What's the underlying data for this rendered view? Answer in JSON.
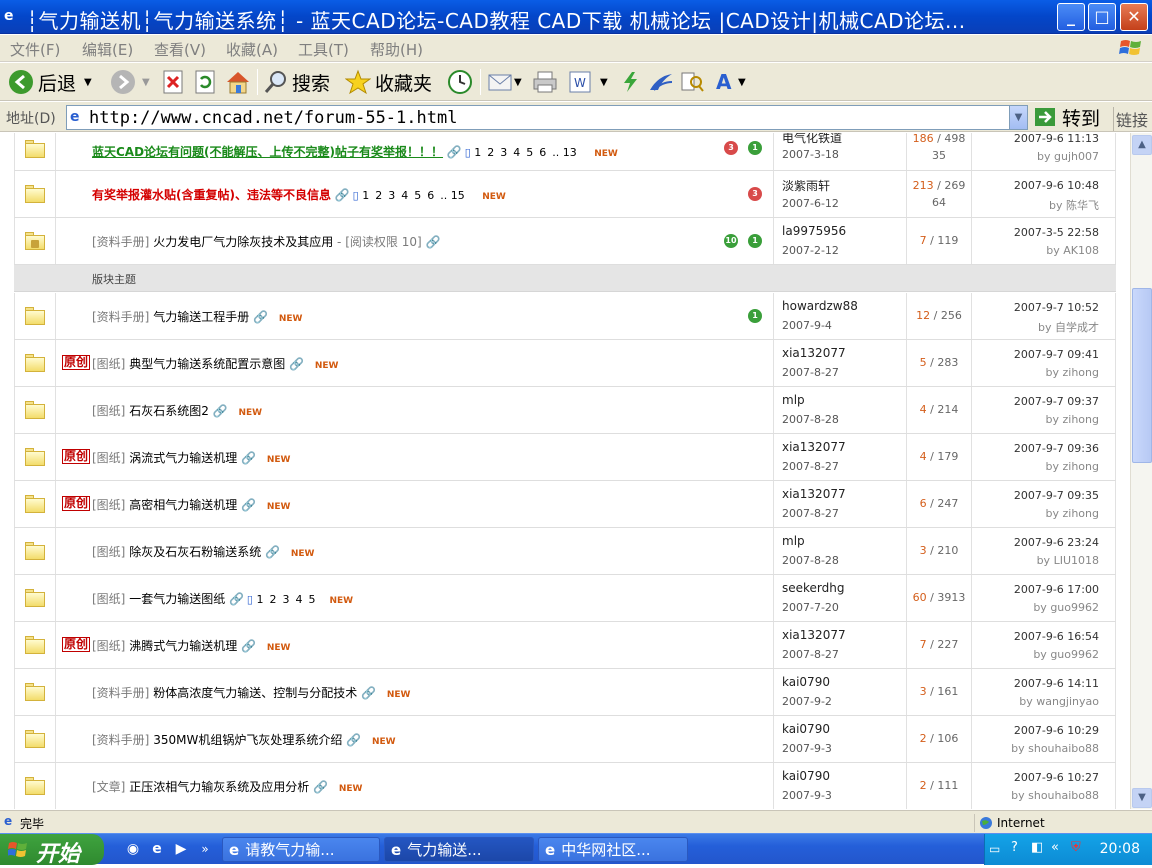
{
  "window": {
    "title": "┆气力输送机┆气力输送系统┆ - 蓝天CAD论坛-CAD教程 CAD下载 机械论坛 |CAD设计|机械CAD论坛...",
    "minimize": "_",
    "maximize": "□",
    "close": "✕"
  },
  "menu": [
    "文件(F)",
    "编辑(E)",
    "查看(V)",
    "收藏(A)",
    "工具(T)",
    "帮助(H)"
  ],
  "toolbar": {
    "back": "后退",
    "search": "搜索",
    "favorites": "收藏夹"
  },
  "address": {
    "label": "地址(D)",
    "url": "http://www.cncad.net/forum-55-1.html",
    "go": "转到",
    "links": "链接"
  },
  "section_label": "版块主题",
  "pinned": [
    {
      "title": "蓝天CAD论坛有问题(不能解压、上传不完整)帖子有奖举报！！！",
      "pages": [
        "1",
        "2",
        "3",
        "4",
        "5",
        "6",
        ".. 13"
      ],
      "new": "NEW",
      "author": "电气化铁道",
      "author_date": "2007-3-18",
      "replies": "186",
      "views": "498",
      "extra": "35",
      "last_date": "2007-9-6 11:13",
      "last_by": "by gujh007",
      "rate_up": "3",
      "rate_green": "1"
    },
    {
      "title": "有奖举报灌水贴(含重复帖)、违法等不良信息",
      "pages": [
        "1",
        "2",
        "3",
        "4",
        "5",
        "6",
        ".. 15"
      ],
      "new": "NEW",
      "author": "淡紫雨轩",
      "author_date": "2007-6-12",
      "replies": "213",
      "views": "269",
      "extra": "64",
      "last_date": "2007-9-6 10:48",
      "last_by": "by 陈华飞",
      "rate_up": "3"
    },
    {
      "category": "[资料手册]",
      "title": "火力发电厂气力除灰技术及其应用",
      "suffix": "- [阅读权限 10]",
      "author": "la9975956",
      "author_date": "2007-2-12",
      "replies": "7",
      "views": "119",
      "last_date": "2007-3-5 22:58",
      "last_by": "by AK108",
      "rate_green_a": "10",
      "rate_green_b": "1"
    }
  ],
  "threads": [
    {
      "tag": "",
      "category": "[资料手册]",
      "title": "气力输送工程手册",
      "pages": [],
      "new": "NEW",
      "author": "howardzw88",
      "author_date": "2007-9-4",
      "replies": "12",
      "views": "256",
      "last_date": "2007-9-7 10:52",
      "last_by": "by 自学成才",
      "rate": "1"
    },
    {
      "tag": "原创",
      "category": "[图纸]",
      "title": "典型气力输送系统配置示意图",
      "pages": [],
      "new": "NEW",
      "author": "xia132077",
      "author_date": "2007-8-27",
      "replies": "5",
      "views": "283",
      "last_date": "2007-9-7 09:41",
      "last_by": "by zihong",
      "rate": ""
    },
    {
      "tag": "",
      "category": "[图纸]",
      "title": "石灰石系统图2",
      "pages": [],
      "new": "NEW",
      "author": "mlp",
      "author_date": "2007-8-28",
      "replies": "4",
      "views": "214",
      "last_date": "2007-9-7 09:37",
      "last_by": "by zihong",
      "rate": ""
    },
    {
      "tag": "原创",
      "category": "[图纸]",
      "title": "涡流式气力输送机理",
      "pages": [],
      "new": "NEW",
      "author": "xia132077",
      "author_date": "2007-8-27",
      "replies": "4",
      "views": "179",
      "last_date": "2007-9-7 09:36",
      "last_by": "by zihong",
      "rate": ""
    },
    {
      "tag": "原创",
      "category": "[图纸]",
      "title": "高密相气力输送机理",
      "pages": [],
      "new": "NEW",
      "author": "xia132077",
      "author_date": "2007-8-27",
      "replies": "6",
      "views": "247",
      "last_date": "2007-9-7 09:35",
      "last_by": "by zihong",
      "rate": ""
    },
    {
      "tag": "",
      "category": "[图纸]",
      "title": "除灰及石灰石粉输送系统",
      "pages": [],
      "new": "NEW",
      "author": "mlp",
      "author_date": "2007-8-28",
      "replies": "3",
      "views": "210",
      "last_date": "2007-9-6 23:24",
      "last_by": "by LIU1018",
      "rate": ""
    },
    {
      "tag": "",
      "category": "[图纸]",
      "title": "一套气力输送图纸",
      "pages": [
        "1",
        "2",
        "3",
        "4",
        "5"
      ],
      "new": "NEW",
      "author": "seekerdhg",
      "author_date": "2007-7-20",
      "replies": "60",
      "views": "3913",
      "last_date": "2007-9-6 17:00",
      "last_by": "by guo9962",
      "rate": ""
    },
    {
      "tag": "原创",
      "category": "[图纸]",
      "title": "沸腾式气力输送机理",
      "pages": [],
      "new": "NEW",
      "author": "xia132077",
      "author_date": "2007-8-27",
      "replies": "7",
      "views": "227",
      "last_date": "2007-9-6 16:54",
      "last_by": "by guo9962",
      "rate": ""
    },
    {
      "tag": "",
      "category": "[资料手册]",
      "title": "粉体高浓度气力输送、控制与分配技术",
      "pages": [],
      "new": "NEW",
      "author": "kai0790",
      "author_date": "2007-9-2",
      "replies": "3",
      "views": "161",
      "last_date": "2007-9-6 14:11",
      "last_by": "by wangjinyao",
      "rate": ""
    },
    {
      "tag": "",
      "category": "[资料手册]",
      "title": "350MW机组锅炉飞灰处理系统介绍",
      "pages": [],
      "new": "NEW",
      "author": "kai0790",
      "author_date": "2007-9-3",
      "replies": "2",
      "views": "106",
      "last_date": "2007-9-6 10:29",
      "last_by": "by shouhaibo88",
      "rate": ""
    },
    {
      "tag": "",
      "category": "[文章]",
      "title": "正压浓相气力输灰系统及应用分析",
      "pages": [],
      "new": "NEW",
      "author": "kai0790",
      "author_date": "2007-9-3",
      "replies": "2",
      "views": "111",
      "last_date": "2007-9-6 10:27",
      "last_by": "by shouhaibo88",
      "rate": ""
    }
  ],
  "status": {
    "text": "完毕",
    "zone": "Internet"
  },
  "taskbar": {
    "start": "开始",
    "tasks": [
      "请教气力输...",
      "气力输送...",
      "中华网社区..."
    ],
    "time": "20:08"
  }
}
